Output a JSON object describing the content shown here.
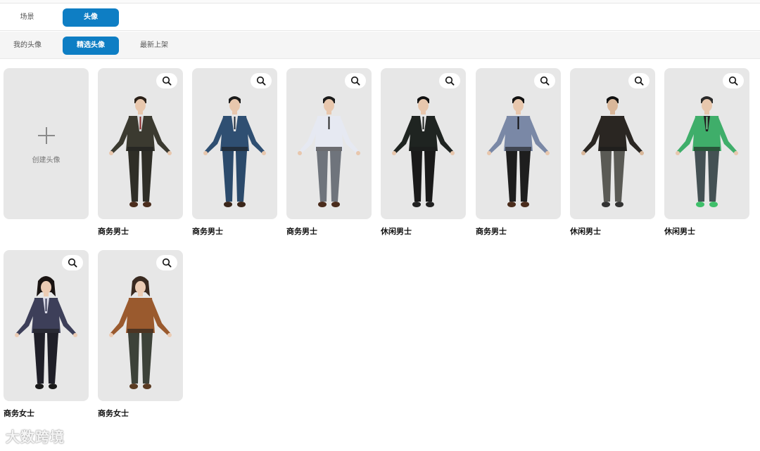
{
  "top_tabs": [
    {
      "label": "场景",
      "active": false
    },
    {
      "label": "头像",
      "active": true
    }
  ],
  "sub_tabs": [
    {
      "label": "我的头像",
      "active": false
    },
    {
      "label": "精选头像",
      "active": true
    },
    {
      "label": "最新上架",
      "active": false
    }
  ],
  "create_card": {
    "label": "创建头像",
    "icon": "plus-icon"
  },
  "avatars": [
    {
      "name": "商务男士",
      "style": "dark-suit-red-tie"
    },
    {
      "name": "商务男士",
      "style": "blue-three-piece-suit"
    },
    {
      "name": "商务男士",
      "style": "white-shirt-grey-trousers"
    },
    {
      "name": "休闲男士",
      "style": "black-shirt"
    },
    {
      "name": "商务男士",
      "style": "grey-shirt-black-tie"
    },
    {
      "name": "休闲男士",
      "style": "black-jacket-back-view"
    },
    {
      "name": "休闲男士",
      "style": "green-puffer-jacket"
    },
    {
      "name": "商务女士",
      "style": "navy-pinstripe-suit"
    },
    {
      "name": "商务女士",
      "style": "brown-top-plaid-trousers"
    }
  ],
  "zoom_icon": "magnifier-icon",
  "watermark": "大数跨境",
  "colors": {
    "accent": "#0e7ec4",
    "card_bg": "#e7e7e7"
  }
}
